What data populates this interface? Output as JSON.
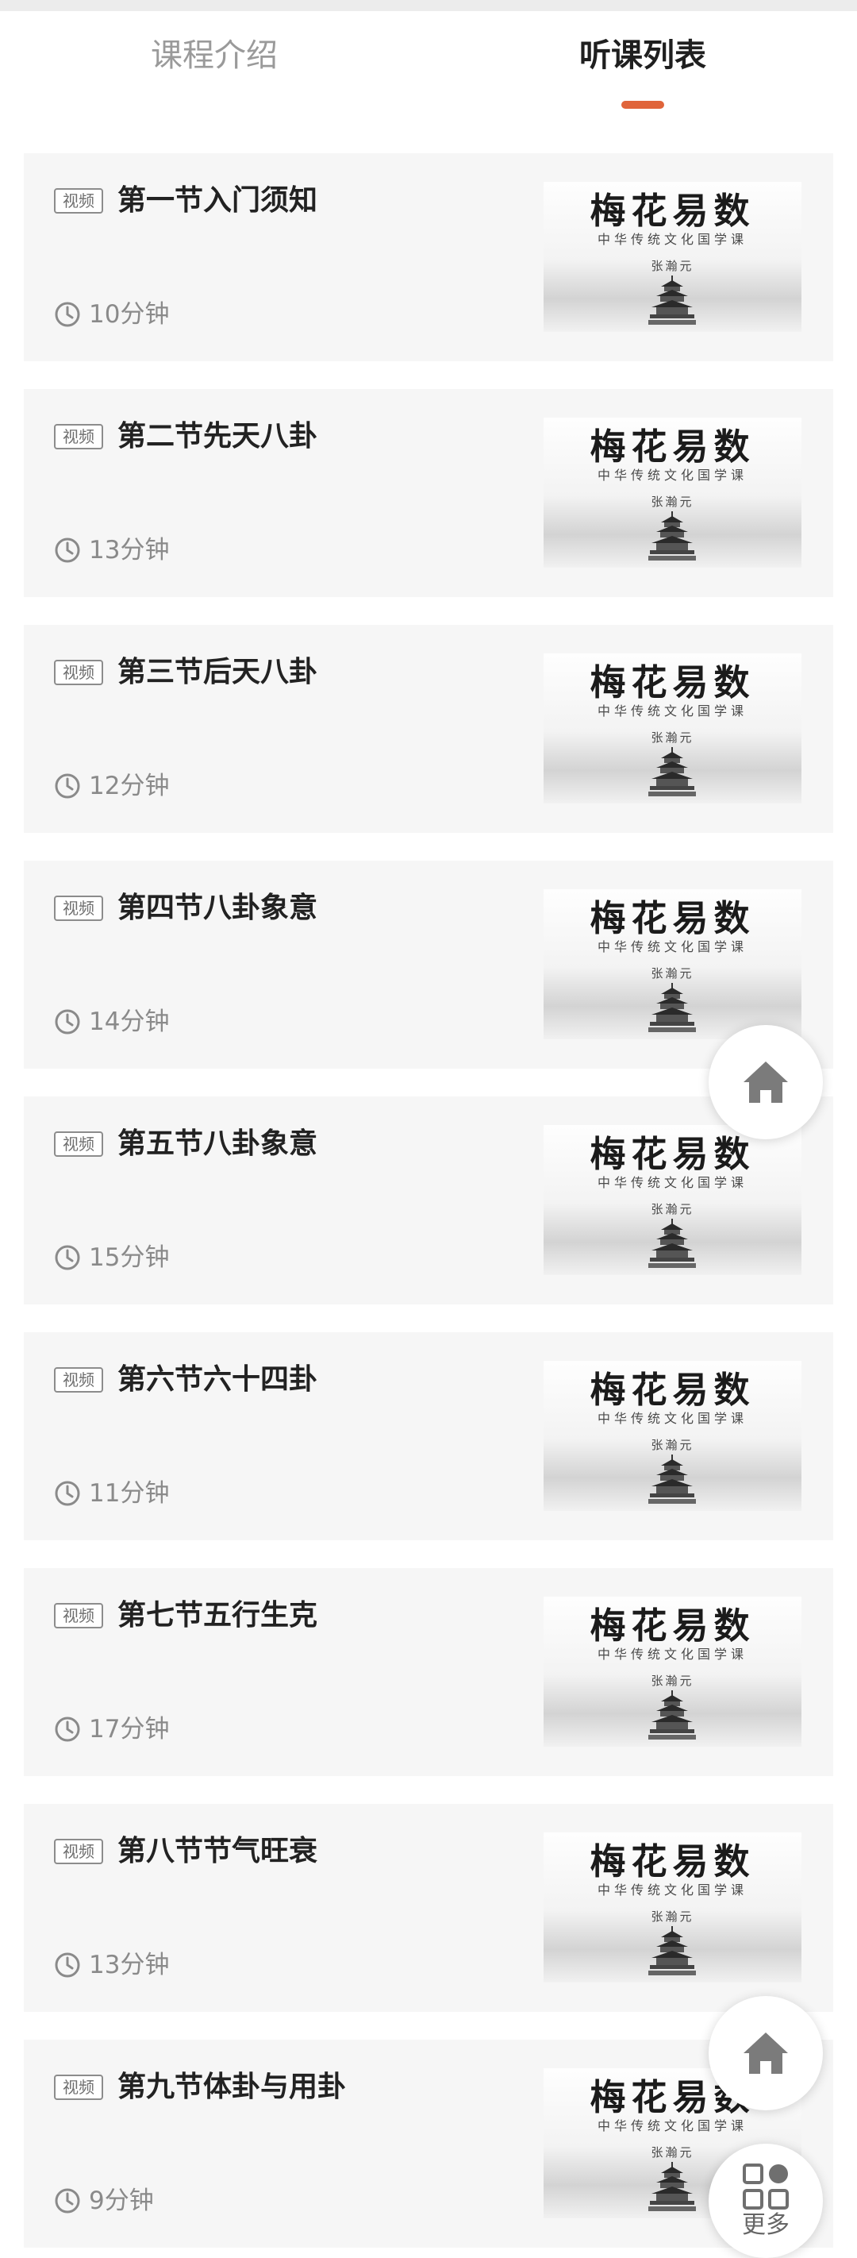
{
  "tabs": [
    {
      "label": "课程介绍",
      "selected": false
    },
    {
      "label": "听课列表",
      "selected": true
    }
  ],
  "accent_color": "#e0643a",
  "lessons": [
    {
      "badge": "视频",
      "title": "第一节入门须知",
      "duration": "10分钟"
    },
    {
      "badge": "视频",
      "title": "第二节先天八卦",
      "duration": "13分钟"
    },
    {
      "badge": "视频",
      "title": "第三节后天八卦",
      "duration": "12分钟"
    },
    {
      "badge": "视频",
      "title": "第四节八卦象意",
      "duration": "14分钟"
    },
    {
      "badge": "视频",
      "title": "第五节八卦象意",
      "duration": "15分钟"
    },
    {
      "badge": "视频",
      "title": "第六节六十四卦",
      "duration": "11分钟"
    },
    {
      "badge": "视频",
      "title": "第七节五行生克",
      "duration": "17分钟"
    },
    {
      "badge": "视频",
      "title": "第八节节气旺衰",
      "duration": "13分钟"
    },
    {
      "badge": "视频",
      "title": "第九节体卦与用卦",
      "duration": "9分钟"
    }
  ],
  "thumbnail": {
    "title": "梅花易数",
    "subtitle": "中华传统文化国学课",
    "author": "张瀚元"
  },
  "float_buttons": {
    "home_icon": "home-icon",
    "more_icon": "grid-icon",
    "more_label": "更多"
  }
}
